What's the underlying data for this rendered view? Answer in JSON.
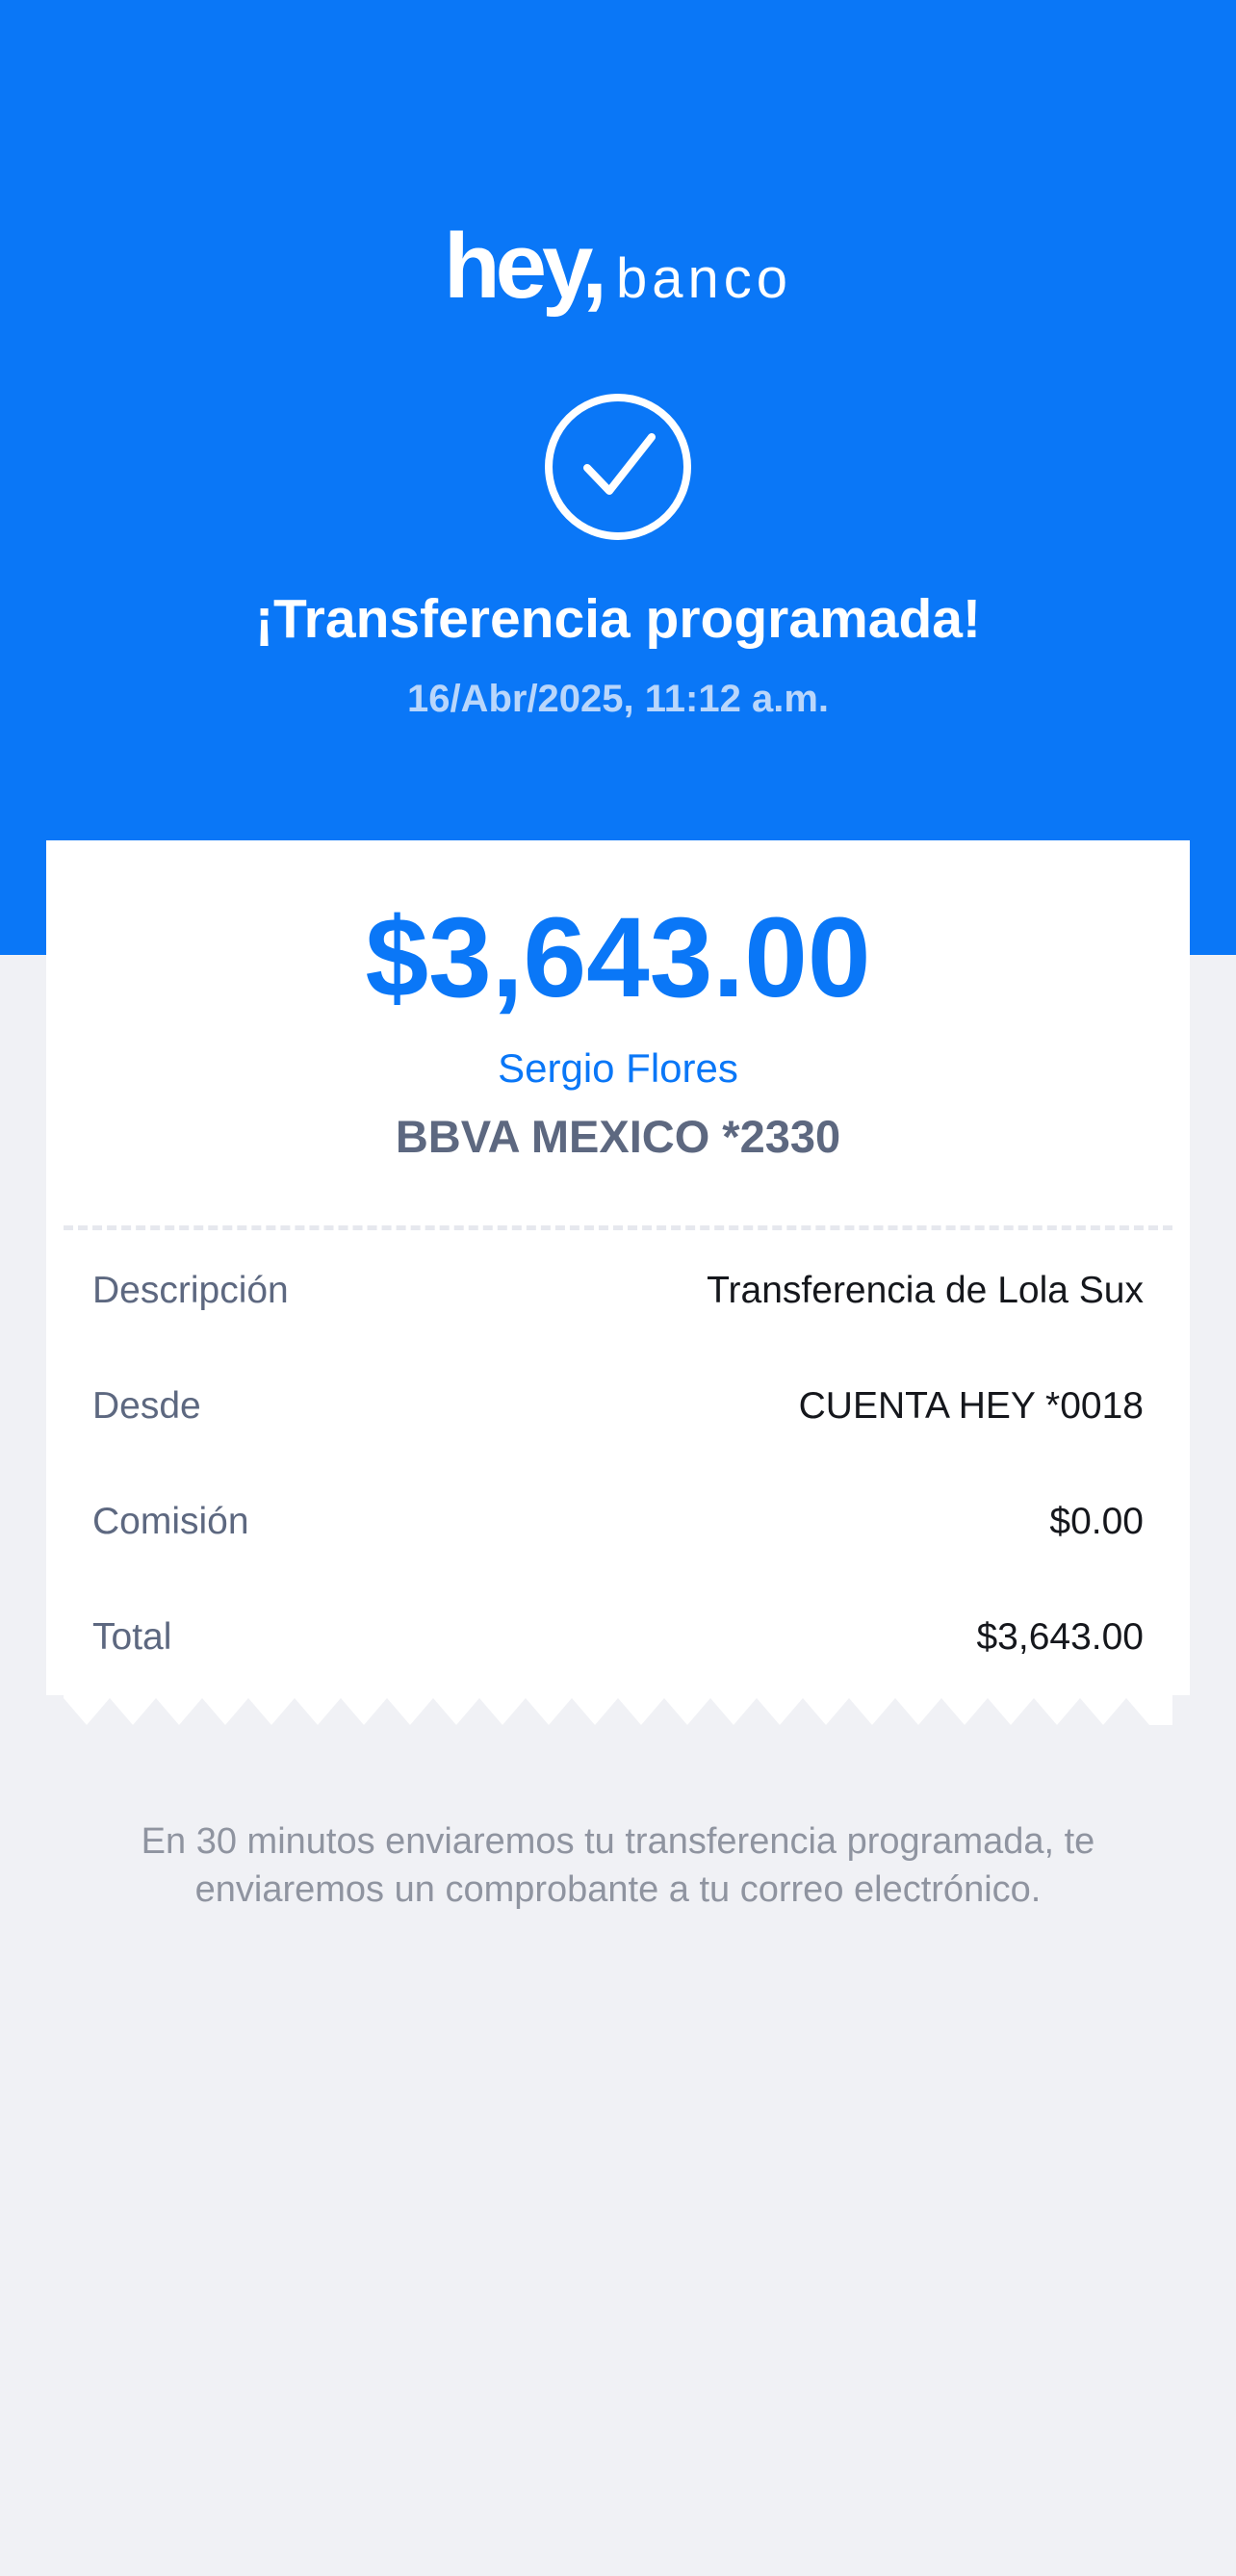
{
  "brand": {
    "logo_word": "hey,",
    "logo_suffix": "banco"
  },
  "status": {
    "icon": "checkmark-circle-icon",
    "title": "¡Transferencia programada!",
    "datetime": "16/Abr/2025, 11:12 a.m."
  },
  "receipt": {
    "amount": "$3,643.00",
    "recipient_name": "Sergio Flores",
    "recipient_account": "BBVA MEXICO *2330",
    "details": [
      {
        "label": "Descripción",
        "value": "Transferencia de Lola Sux"
      },
      {
        "label": "Desde",
        "value": "CUENTA HEY *0018"
      },
      {
        "label": "Comisión",
        "value": "$0.00"
      },
      {
        "label": "Total",
        "value": "$3,643.00"
      }
    ]
  },
  "footer_note": "En 30 minutos enviaremos tu transferencia programada, te enviaremos un comprobante a tu correo electrónico.",
  "colors": {
    "brand_blue": "#0a77f7",
    "background": "#f0f1f5",
    "muted_text": "#5d6880"
  }
}
